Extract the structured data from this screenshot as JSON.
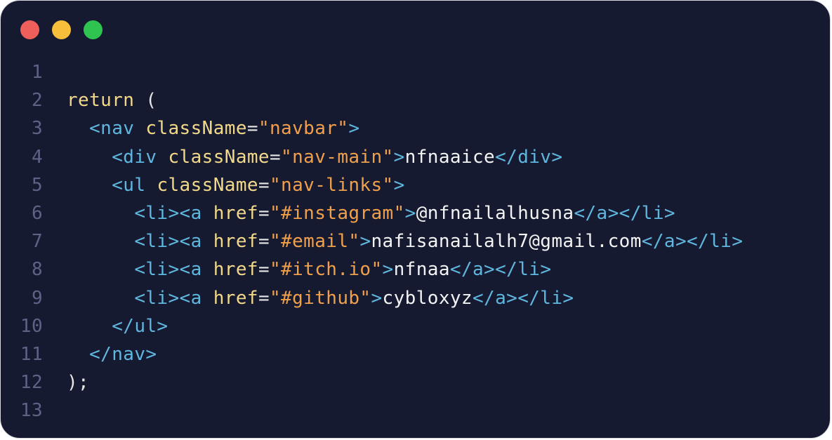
{
  "window": {
    "controls": [
      {
        "name": "close",
        "color": "#ee5f5b"
      },
      {
        "name": "minimize",
        "color": "#f6be3b"
      },
      {
        "name": "maximize",
        "color": "#2fc44f"
      }
    ]
  },
  "colors": {
    "background": "#161a30",
    "keyword": "#f2d889",
    "tag": "#5fb6df",
    "string": "#f0a04b",
    "text": "#f3f3f3",
    "line_number": "#5d6385"
  },
  "code": {
    "lines": [
      {
        "number": "1",
        "tokens": []
      },
      {
        "number": "2",
        "tokens": [
          {
            "t": "kw",
            "v": "return"
          },
          {
            "t": "punct",
            "v": " ("
          }
        ]
      },
      {
        "number": "3",
        "tokens": [
          {
            "t": "punct",
            "v": "  "
          },
          {
            "t": "tag",
            "v": "<nav"
          },
          {
            "t": "punct",
            "v": " "
          },
          {
            "t": "attr",
            "v": "className"
          },
          {
            "t": "punct",
            "v": "="
          },
          {
            "t": "str",
            "v": "\"navbar\""
          },
          {
            "t": "tag",
            "v": ">"
          }
        ]
      },
      {
        "number": "4",
        "tokens": [
          {
            "t": "punct",
            "v": "    "
          },
          {
            "t": "tag",
            "v": "<div"
          },
          {
            "t": "punct",
            "v": " "
          },
          {
            "t": "attr",
            "v": "className"
          },
          {
            "t": "punct",
            "v": "="
          },
          {
            "t": "str",
            "v": "\"nav-main\""
          },
          {
            "t": "tag",
            "v": ">"
          },
          {
            "t": "txt",
            "v": "nfnaaice"
          },
          {
            "t": "tag",
            "v": "</div>"
          }
        ]
      },
      {
        "number": "5",
        "tokens": [
          {
            "t": "punct",
            "v": "    "
          },
          {
            "t": "tag",
            "v": "<ul"
          },
          {
            "t": "punct",
            "v": " "
          },
          {
            "t": "attr",
            "v": "className"
          },
          {
            "t": "punct",
            "v": "="
          },
          {
            "t": "str",
            "v": "\"nav-links\""
          },
          {
            "t": "tag",
            "v": ">"
          }
        ]
      },
      {
        "number": "6",
        "tokens": [
          {
            "t": "punct",
            "v": "      "
          },
          {
            "t": "tag",
            "v": "<li><a"
          },
          {
            "t": "punct",
            "v": " "
          },
          {
            "t": "attr",
            "v": "href"
          },
          {
            "t": "punct",
            "v": "="
          },
          {
            "t": "str",
            "v": "\"#instagram\""
          },
          {
            "t": "tag",
            "v": ">"
          },
          {
            "t": "txt",
            "v": "@nfnailalhusna"
          },
          {
            "t": "tag",
            "v": "</a></li>"
          }
        ]
      },
      {
        "number": "7",
        "tokens": [
          {
            "t": "punct",
            "v": "      "
          },
          {
            "t": "tag",
            "v": "<li><a"
          },
          {
            "t": "punct",
            "v": " "
          },
          {
            "t": "attr",
            "v": "href"
          },
          {
            "t": "punct",
            "v": "="
          },
          {
            "t": "str",
            "v": "\"#email\""
          },
          {
            "t": "tag",
            "v": ">"
          },
          {
            "t": "txt",
            "v": "nafisanailalh7@gmail.com"
          },
          {
            "t": "tag",
            "v": "</a></li>"
          }
        ]
      },
      {
        "number": "8",
        "tokens": [
          {
            "t": "punct",
            "v": "      "
          },
          {
            "t": "tag",
            "v": "<li><a"
          },
          {
            "t": "punct",
            "v": " "
          },
          {
            "t": "attr",
            "v": "href"
          },
          {
            "t": "punct",
            "v": "="
          },
          {
            "t": "str",
            "v": "\"#itch.io\""
          },
          {
            "t": "tag",
            "v": ">"
          },
          {
            "t": "txt",
            "v": "nfnaa"
          },
          {
            "t": "tag",
            "v": "</a></li>"
          }
        ]
      },
      {
        "number": "9",
        "tokens": [
          {
            "t": "punct",
            "v": "      "
          },
          {
            "t": "tag",
            "v": "<li><a"
          },
          {
            "t": "punct",
            "v": " "
          },
          {
            "t": "attr",
            "v": "href"
          },
          {
            "t": "punct",
            "v": "="
          },
          {
            "t": "str",
            "v": "\"#github\""
          },
          {
            "t": "tag",
            "v": ">"
          },
          {
            "t": "txt",
            "v": "cybloxyz"
          },
          {
            "t": "tag",
            "v": "</a></li>"
          }
        ]
      },
      {
        "number": "10",
        "tokens": [
          {
            "t": "punct",
            "v": "    "
          },
          {
            "t": "tag",
            "v": "</ul>"
          }
        ]
      },
      {
        "number": "11",
        "tokens": [
          {
            "t": "punct",
            "v": "  "
          },
          {
            "t": "tag",
            "v": "</nav>"
          }
        ]
      },
      {
        "number": "12",
        "tokens": [
          {
            "t": "punct",
            "v": ");"
          }
        ]
      },
      {
        "number": "13",
        "tokens": []
      }
    ]
  }
}
